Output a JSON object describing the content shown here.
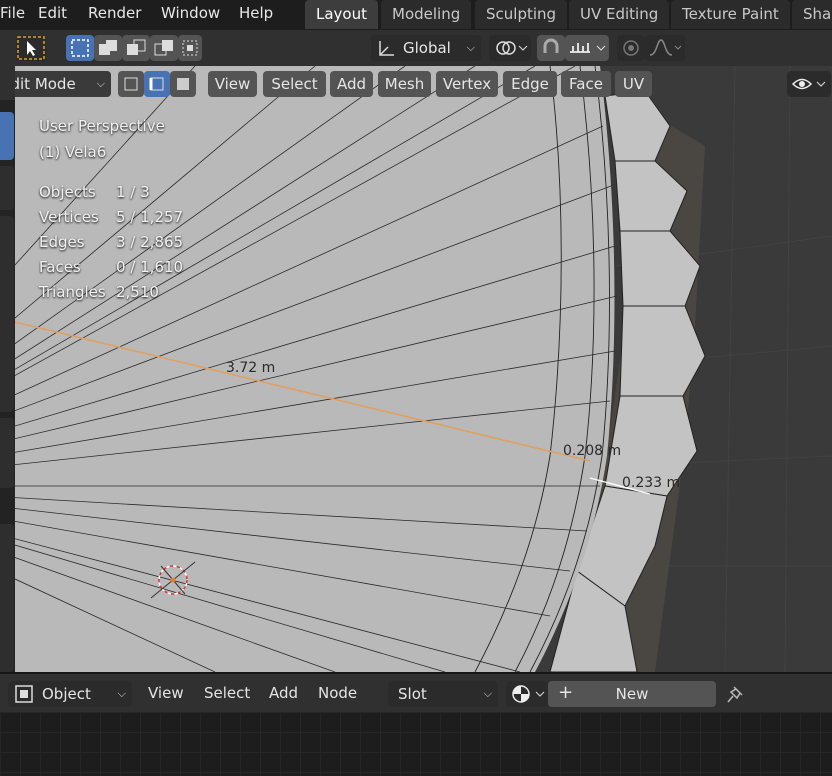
{
  "menu": {
    "items": [
      {
        "key": "file",
        "label": "File"
      },
      {
        "key": "edit",
        "label": "Edit"
      },
      {
        "key": "render",
        "label": "Render"
      },
      {
        "key": "window",
        "label": "Window"
      },
      {
        "key": "help",
        "label": "Help"
      }
    ]
  },
  "workspaces": [
    {
      "label": "Layout",
      "active": true
    },
    {
      "label": "Modeling",
      "active": false
    },
    {
      "label": "Sculpting",
      "active": false
    },
    {
      "label": "UV Editing",
      "active": false
    },
    {
      "label": "Texture Paint",
      "active": false
    },
    {
      "label": "Shad",
      "active": false
    }
  ],
  "toolbar": {
    "transform_orientation": "Global"
  },
  "header3d": {
    "mode": "Edit Mode",
    "menus": [
      "View",
      "Select",
      "Add",
      "Mesh",
      "Vertex",
      "Edge",
      "Face",
      "UV"
    ]
  },
  "overlay": {
    "view_name": "User Perspective",
    "object_name": "(1) Vela6",
    "stats": [
      {
        "label": "Objects",
        "value": "1 / 3"
      },
      {
        "label": "Vertices",
        "value": "5 / 1,257"
      },
      {
        "label": "Edges",
        "value": "3 / 2,865"
      },
      {
        "label": "Faces",
        "value": "0 / 1,610"
      },
      {
        "label": "Triangles",
        "value": "2,510"
      }
    ]
  },
  "measurements": {
    "long_edge": "3.72 m",
    "short_edge": "0.208 m",
    "outer_edge": "0.233 m"
  },
  "node_editor": {
    "object_mode": "Object",
    "menus": [
      "View",
      "Select",
      "Add",
      "Node"
    ],
    "slot": "Slot",
    "new_label": "New"
  },
  "colors": {
    "accent": "#4772b3",
    "active_edge": "#e0a060",
    "mesh_face": "#b9b9b9"
  }
}
